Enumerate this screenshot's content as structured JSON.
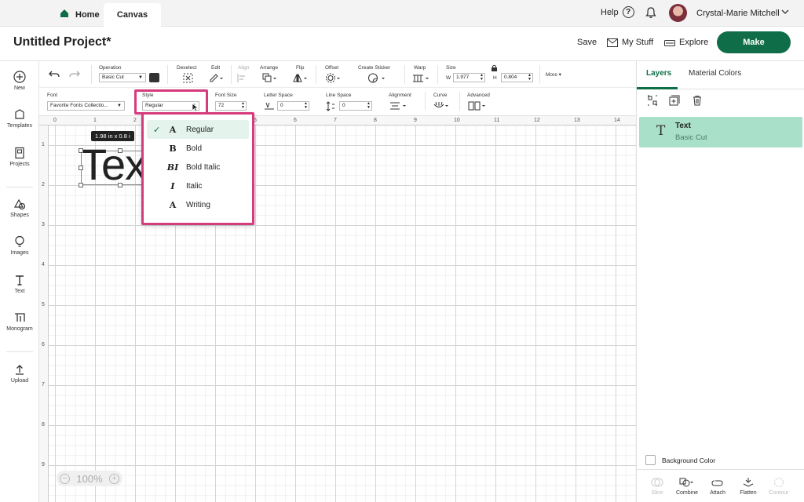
{
  "tabs": {
    "home": "Home",
    "canvas": "Canvas"
  },
  "header": {
    "help": "Help",
    "user_name": "Crystal-Marie Mitchell"
  },
  "project": {
    "title": "Untitled Project*",
    "save": "Save",
    "my_stuff": "My Stuff",
    "explore": "Explore",
    "make": "Make"
  },
  "sidebar": {
    "new": "New",
    "templates": "Templates",
    "projects": "Projects",
    "shapes": "Shapes",
    "images": "Images",
    "text": "Text",
    "monogram": "Monogram",
    "upload": "Upload"
  },
  "toolbar1": {
    "operation_label": "Operation",
    "operation_value": "Basic Cut",
    "deselect": "Deselect",
    "edit": "Edit",
    "align": "Align",
    "arrange": "Arrange",
    "flip": "Flip",
    "offset": "Offset",
    "create_sticker": "Create Sticker",
    "warp": "Warp",
    "size": "Size",
    "w_label": "W",
    "w_value": "1.977",
    "h_label": "H",
    "h_value": "0.804",
    "more": "More"
  },
  "toolbar2": {
    "font_label": "Font",
    "font_value": "Favorite Fonts Collectio...",
    "style_label": "Style",
    "style_value": "Regular",
    "font_size_label": "Font Size",
    "font_size_value": "72",
    "letter_space_label": "Letter Space",
    "letter_space_value": "0",
    "line_space_label": "Line Space",
    "line_space_value": "0",
    "alignment_label": "Alignment",
    "curve_label": "Curve",
    "advanced_label": "Advanced"
  },
  "style_dropdown": [
    {
      "glyph": "A",
      "label": "Regular",
      "selected": true
    },
    {
      "glyph": "B",
      "label": "Bold",
      "selected": false
    },
    {
      "glyph": "BI",
      "label": "Bold Italic",
      "selected": false
    },
    {
      "glyph": "I",
      "label": "Italic",
      "selected": false
    },
    {
      "glyph": "A",
      "label": "Writing",
      "selected": false
    }
  ],
  "canvas": {
    "ruler_x": [
      "0",
      "1",
      "2",
      "3",
      "4",
      "5",
      "6",
      "7",
      "8",
      "9",
      "10",
      "11",
      "12",
      "13",
      "14"
    ],
    "ruler_y": [
      "1",
      "2",
      "3",
      "4",
      "5",
      "6",
      "7",
      "8",
      "9"
    ],
    "text_object": "Tex",
    "size_tooltip": "1.98  in x 0.8  i",
    "zoom": "100%"
  },
  "right_panel": {
    "tab_layers": "Layers",
    "tab_material": "Material Colors",
    "layer_title": "Text",
    "layer_sub": "Basic Cut",
    "background_color": "Background Color",
    "slice": "Slice",
    "combine": "Combine",
    "attach": "Attach",
    "flatten": "Flatten",
    "contour": "Contour"
  },
  "colors": {
    "accent": "#0f6e47",
    "highlight": "#d63b7d",
    "layer_bg": "#a9e0ca"
  }
}
